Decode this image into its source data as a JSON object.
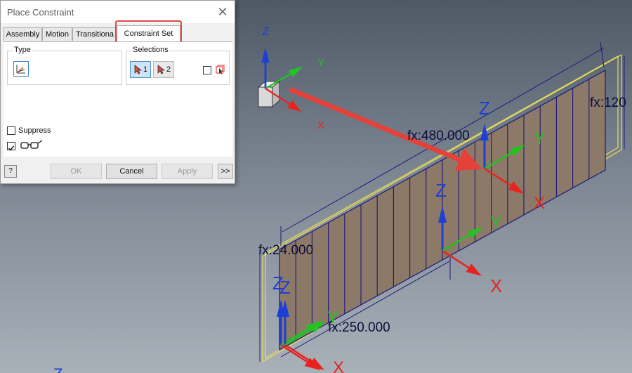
{
  "dialog": {
    "title": "Place Constraint",
    "close_icon": "close-icon",
    "tabs": [
      {
        "label": "Assembly",
        "active": false
      },
      {
        "label": "Motion",
        "active": false
      },
      {
        "label": "Transitiona",
        "active": false
      },
      {
        "label": "Constraint Set",
        "active": true
      }
    ],
    "type_label": "Type",
    "type_icon": "ucs-constraint-icon",
    "selections_label": "Selections",
    "selection_buttons": [
      {
        "label": "1",
        "icon": "select-arrow-icon",
        "active": true
      },
      {
        "label": "2",
        "icon": "select-arrow-icon",
        "active": false
      }
    ],
    "pick_part_first_icon": "pick-part-icon",
    "suppress_label": "Suppress",
    "suppress_checked": false,
    "preview_checked": true,
    "preview_icon": "glasses-icon",
    "help_label": "?",
    "buttons": {
      "ok": "OK",
      "cancel": "Cancel",
      "apply": "Apply",
      "more": ">>"
    }
  },
  "viewport": {
    "axis_labels": {
      "x": "X",
      "y": "Y",
      "z": "Z"
    },
    "dimensions": [
      "fx:480.000",
      "fx:120",
      "fx:24.000",
      "fx:250.000"
    ],
    "colors": {
      "x_axis": "#e8231f",
      "y_axis": "#22c322",
      "z_axis": "#1d3fd6",
      "panel_fill": "#8c7968",
      "panel_frame": "#e8de5a",
      "dimension_line": "#1a1a7a",
      "callout_arrow": "#e5413b"
    }
  }
}
